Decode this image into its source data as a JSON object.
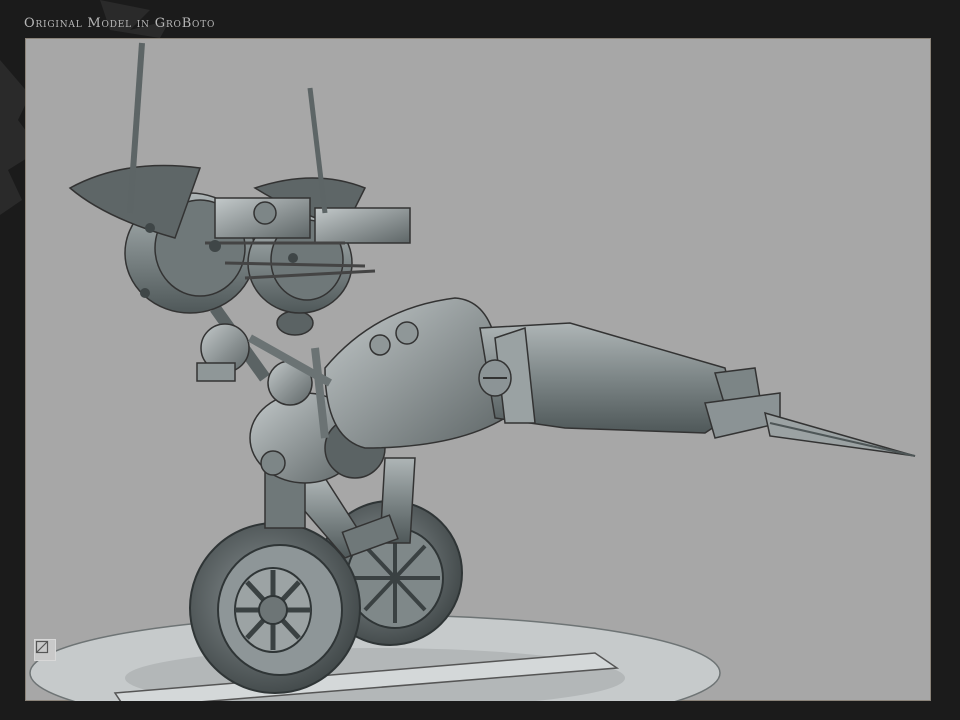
{
  "header": {
    "title": "Original Model in GroBoto"
  },
  "viewport": {
    "background_color": "#a7a7a7",
    "model_color": "#8a9294",
    "corner_icon": "render-mode-icon"
  }
}
